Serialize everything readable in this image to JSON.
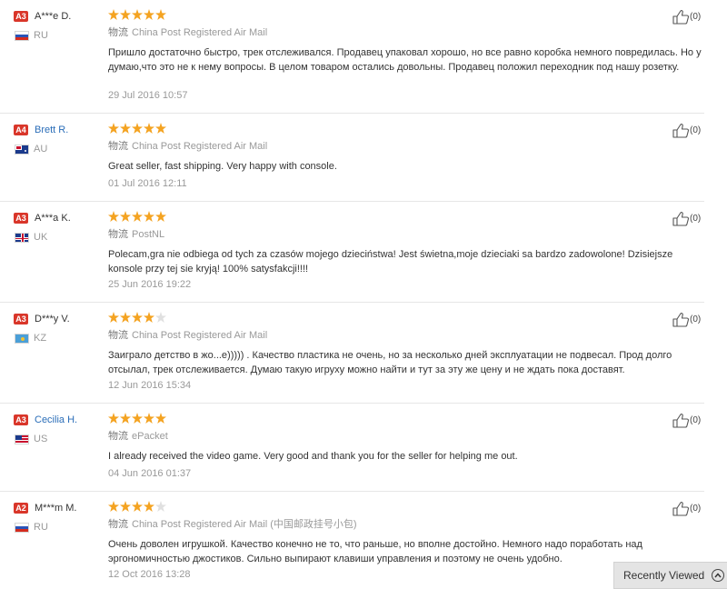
{
  "reviews": [
    {
      "badge": "A3",
      "name": "A***e D.",
      "country": "RU",
      "stars": 5,
      "shipping_label": "物流",
      "shipping": "China Post Registered Air Mail",
      "comment": "Пришло достаточно быстро, трек отслеживался. Продавец упаковал хорошо, но все равно коробка немного повредилась. Но у думаю,что это не к нему вопросы. В целом товаром остались довольны. Продавец положил переходник под нашу розетку.",
      "date": "29 Jul 2016 10:57",
      "likes": "(0)"
    },
    {
      "badge": "A4",
      "name": "Brett R.",
      "country": "AU",
      "stars": 5,
      "shipping_label": "物流",
      "shipping": "China Post Registered Air Mail",
      "comment": "Great seller, fast shipping. Very happy with console.",
      "date": "01 Jul 2016 12:11",
      "likes": "(0)"
    },
    {
      "badge": "A3",
      "name": "A***a K.",
      "country": "UK",
      "stars": 5,
      "shipping_label": "物流",
      "shipping": "PostNL",
      "comment": "Polecam,gra nie odbiega od tych za czasów mojego dzieciństwa! Jest świetna,moje dzieciaki sa bardzo zadowolone! Dzisiejsze konsole przy tej sie kryją! 100% satysfakcji!!!!",
      "date": "25 Jun 2016 19:22",
      "likes": "(0)"
    },
    {
      "badge": "A3",
      "name": "D***y V.",
      "country": "KZ",
      "stars": 4,
      "shipping_label": "物流",
      "shipping": "China Post Registered Air Mail",
      "comment": "Заиграло детство в жо...е))))) . Качество пластика не очень, но за несколько дней эксплуатации не подвесал. Прод долго отсылал, трек отслеживается. Думаю такую игруху можно найти и тут за эту же цену и не ждать пока доставят.",
      "date": "12 Jun 2016 15:34",
      "likes": "(0)"
    },
    {
      "badge": "A3",
      "name": "Cecilia H.",
      "country": "US",
      "stars": 5,
      "shipping_label": "物流",
      "shipping": "ePacket",
      "comment": "I already received the video game. Very good and thank you for the seller for helping me out.",
      "date": "04 Jun 2016 01:37",
      "likes": "(0)"
    },
    {
      "badge": "A2",
      "name": "M***m M.",
      "country": "RU",
      "stars": 4,
      "shipping_label": "物流",
      "shipping": "China Post Registered Air Mail (中国邮政挂号小包)",
      "comment": "Очень доволен игрушкой. Качество конечно не то, что раньше, но вполне достойно. Немного надо поработать над эргономичностью джостиков. Сильно выпирают клавиши управления и поэтому не очень удобно.",
      "date": "12 Oct 2016 13:28",
      "likes": "(0)"
    }
  ],
  "recently_viewed": "Recently Viewed",
  "colors": {
    "star_on": "#f4a321",
    "star_off": "#e0e0e0",
    "badge": "#d9362a",
    "link_name": "#2a6db8"
  }
}
